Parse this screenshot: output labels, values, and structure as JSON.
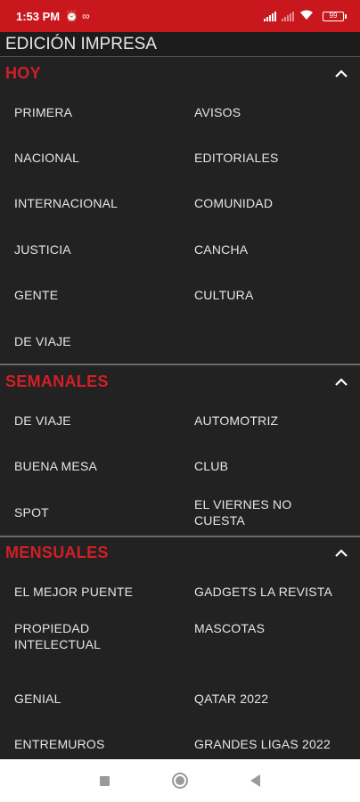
{
  "status_bar": {
    "time": "1:53 PM",
    "battery": "99"
  },
  "page_title": "EDICIÓN IMPRESA",
  "sections": [
    {
      "title": "HOY",
      "items": [
        "PRIMERA",
        "AVISOS",
        "NACIONAL",
        "EDITORIALES",
        "INTERNACIONAL",
        "COMUNIDAD",
        "JUSTICIA",
        "CANCHA",
        "GENTE",
        "CULTURA",
        "DE VIAJE"
      ]
    },
    {
      "title": "SEMANALES",
      "items": [
        "DE VIAJE",
        "AUTOMOTRIZ",
        "BUENA MESA",
        "CLUB",
        "SPOT",
        "EL VIERNES NO CUESTA"
      ]
    },
    {
      "title": "MENSUALES",
      "items": [
        "EL MEJOR PUENTE",
        "GADGETS LA REVISTA",
        "PROPIEDAD INTELECTUAL",
        "MASCOTAS",
        "GENIAL",
        "QATAR 2022",
        "ENTREMUROS",
        "GRANDES LIGAS 2022"
      ]
    }
  ],
  "colors": {
    "accent": "#d21f26",
    "status_bar": "#c8181e",
    "background": "#222222"
  },
  "icons": {
    "section_toggle": "chevron-up-icon",
    "nav_recents": "square-icon",
    "nav_home": "circle-icon",
    "nav_back": "triangle-back-icon"
  }
}
